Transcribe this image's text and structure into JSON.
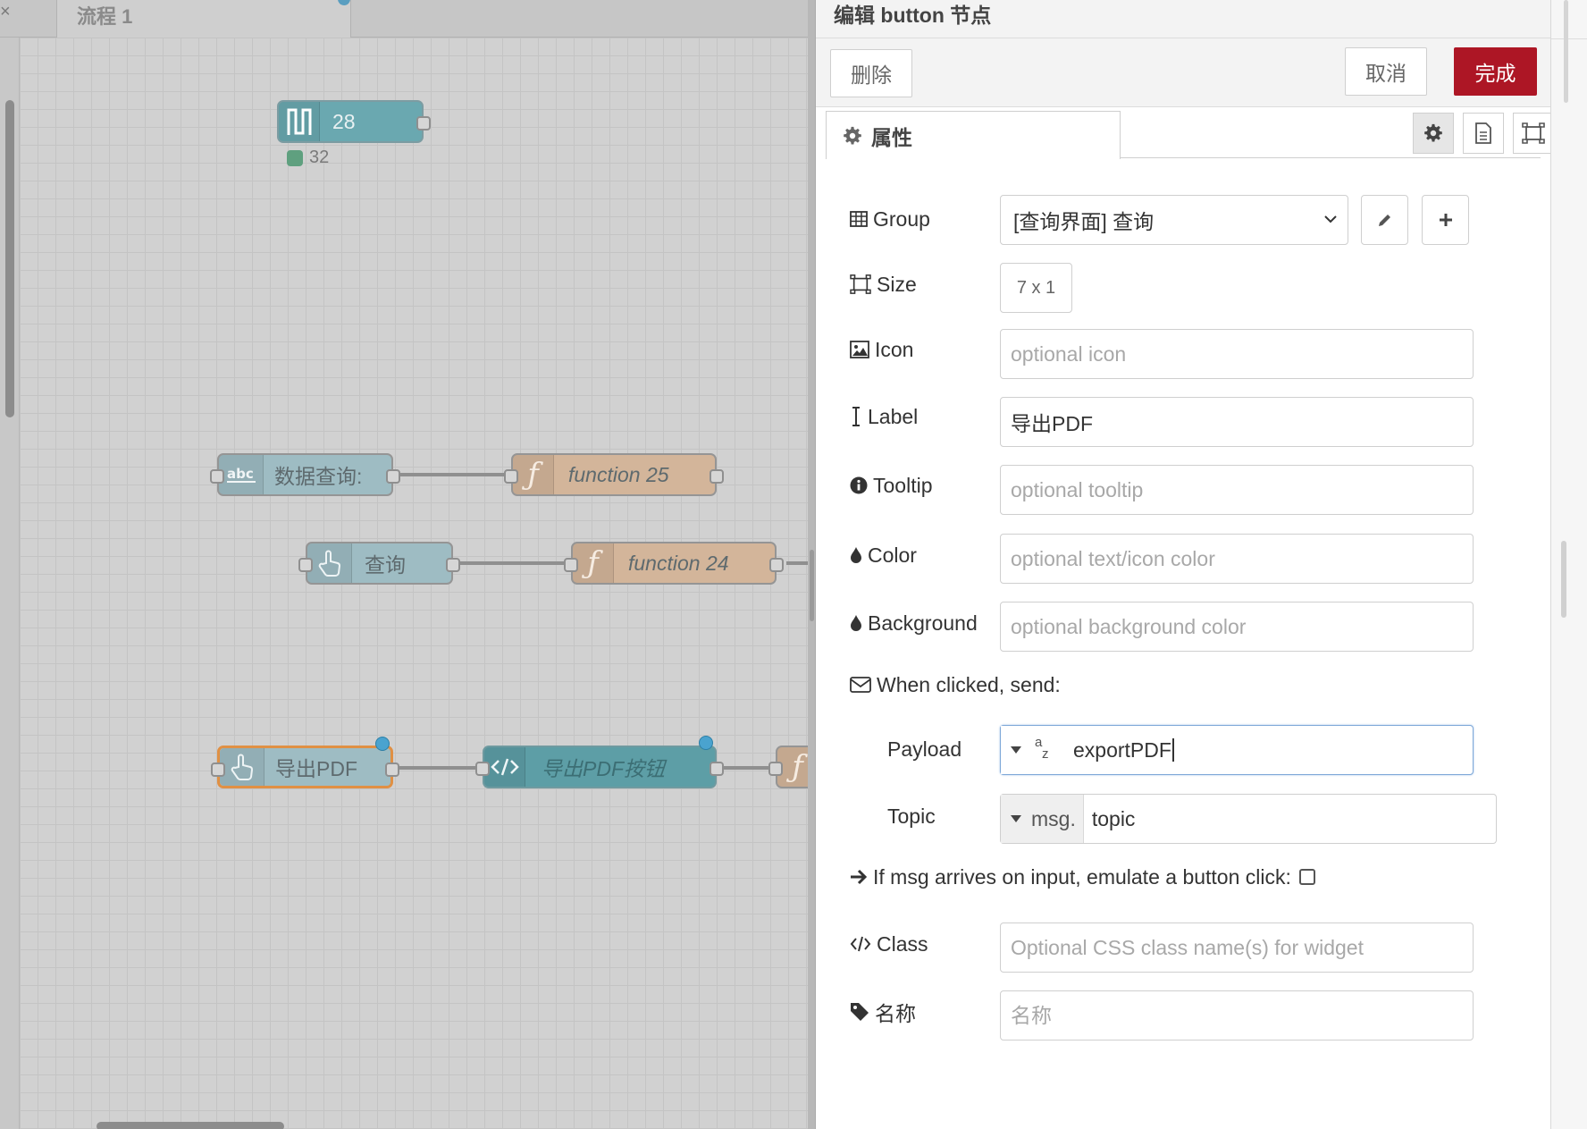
{
  "workspace": {
    "tab_close": "×",
    "flow_tab": "流程 1",
    "nodes": {
      "trigger": {
        "label": "28",
        "status": "32"
      },
      "text_query": {
        "label": "数据查询:"
      },
      "function25": {
        "label": "function 25"
      },
      "query_btn": {
        "label": "查询"
      },
      "function24": {
        "label": "function 24"
      },
      "export_btn": {
        "label": "导出PDF"
      },
      "template": {
        "label": "导出PDF按钮"
      }
    }
  },
  "tray": {
    "title": "编辑 button 节点",
    "delete": "删除",
    "cancel": "取消",
    "done": "完成",
    "tab_properties": "属性",
    "group": {
      "label": "Group",
      "value": "[查询界面] 查询"
    },
    "size": {
      "label": "Size",
      "value": "7 x 1"
    },
    "icon": {
      "label": "Icon",
      "placeholder": "optional icon"
    },
    "label": {
      "label": "Label",
      "value": "导出PDF"
    },
    "tooltip": {
      "label": "Tooltip",
      "placeholder": "optional tooltip"
    },
    "color": {
      "label": "Color",
      "placeholder": "optional text/icon color"
    },
    "background": {
      "label": "Background",
      "placeholder": "optional background color"
    },
    "when_clicked": "When clicked, send:",
    "payload": {
      "label": "Payload",
      "type_glyph_top": "a",
      "type_glyph_bottom": "z",
      "value": "exportPDF"
    },
    "topic": {
      "label": "Topic",
      "type": "msg.",
      "value": "topic"
    },
    "emulate": "If msg arrives on input, emulate a button click:",
    "class": {
      "label": "Class",
      "placeholder": "Optional CSS class name(s) for widget"
    },
    "name": {
      "label": "名称",
      "placeholder": "名称"
    }
  },
  "colors": {
    "done_button": "#ad1625",
    "link_dot": "#4aa3cf",
    "function_node": "#d3b59a",
    "ui_node": "#9ebcc3"
  }
}
